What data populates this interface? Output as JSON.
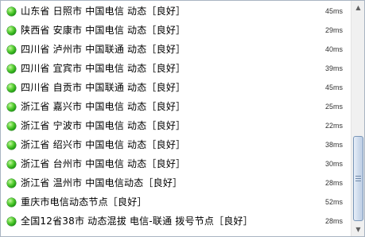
{
  "rows": [
    {
      "label": "山东省 日照市 中国电信 动态［良好］",
      "ms": "45ms"
    },
    {
      "label": "陕西省 安康市 中国电信 动态［良好］",
      "ms": "29ms"
    },
    {
      "label": "四川省 泸州市 中国联通 动态［良好］",
      "ms": "40ms"
    },
    {
      "label": "四川省 宜宾市 中国电信 动态［良好］",
      "ms": "39ms"
    },
    {
      "label": "四川省 自贡市 中国联通 动态［良好］",
      "ms": "45ms"
    },
    {
      "label": "浙江省 嘉兴市 中国电信 动态［良好］",
      "ms": "25ms"
    },
    {
      "label": "浙江省 宁波市 中国电信 动态［良好］",
      "ms": "22ms"
    },
    {
      "label": "浙江省 绍兴市 中国电信 动态［良好］",
      "ms": "38ms"
    },
    {
      "label": "浙江省 台州市 中国电信 动态［良好］",
      "ms": "30ms"
    },
    {
      "label": "浙江省 温州市 中国电信动态［良好］",
      "ms": "28ms"
    },
    {
      "label": "重庆市电信动态节点［良好］",
      "ms": "52ms"
    },
    {
      "label": "全国12省38市 动态混拔 电信-联通 拨号节点［良好］",
      "ms": "28ms"
    }
  ],
  "status_color": "#22a012",
  "scrollbar": {
    "up_icon": "arrow-up-icon",
    "down_icon": "arrow-down-icon"
  }
}
